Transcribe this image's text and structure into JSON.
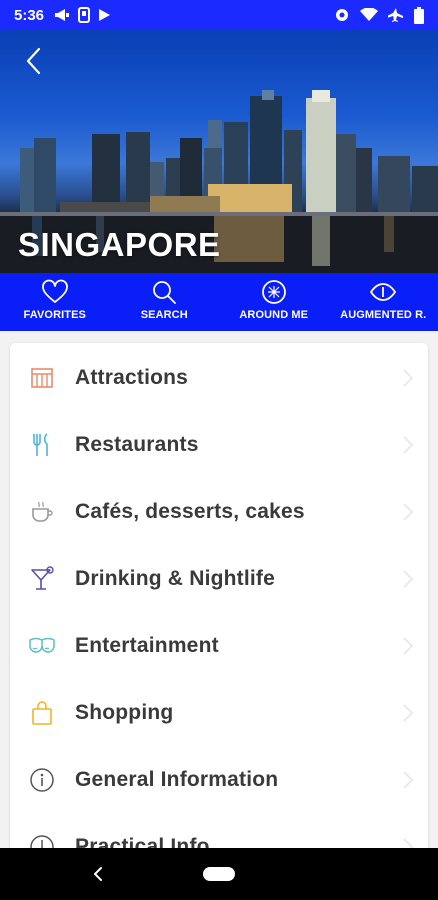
{
  "status_bar": {
    "time": "5:36"
  },
  "hero": {
    "city_title": "SINGAPORE"
  },
  "nav": {
    "items": [
      {
        "label": "FAVORITES",
        "icon": "heart-icon"
      },
      {
        "label": "SEARCH",
        "icon": "search-icon"
      },
      {
        "label": "AROUND ME",
        "icon": "compass-icon"
      },
      {
        "label": "AUGMENTED R.",
        "icon": "eye-icon"
      }
    ]
  },
  "categories": [
    {
      "label": "Attractions",
      "icon": "attractions-icon",
      "color": "#e88b6a"
    },
    {
      "label": "Restaurants",
      "icon": "fork-knife-icon",
      "color": "#4fb3d9"
    },
    {
      "label": "Cafés, desserts, cakes",
      "icon": "coffee-cup-icon",
      "color": "#9a9a9a"
    },
    {
      "label": "Drinking & Nightlife",
      "icon": "cocktail-icon",
      "color": "#5a4fa8"
    },
    {
      "label": "Entertainment",
      "icon": "theater-masks-icon",
      "color": "#5bbfc4"
    },
    {
      "label": "Shopping",
      "icon": "shopping-bag-icon",
      "color": "#f0b429"
    },
    {
      "label": "General Information",
      "icon": "info-icon",
      "color": "#555555"
    },
    {
      "label": "Practical Info",
      "icon": "practical-info-icon",
      "color": "#555555"
    }
  ],
  "colors": {
    "brand_blue": "#0a1ff7",
    "status_blue": "#1b2bff"
  }
}
